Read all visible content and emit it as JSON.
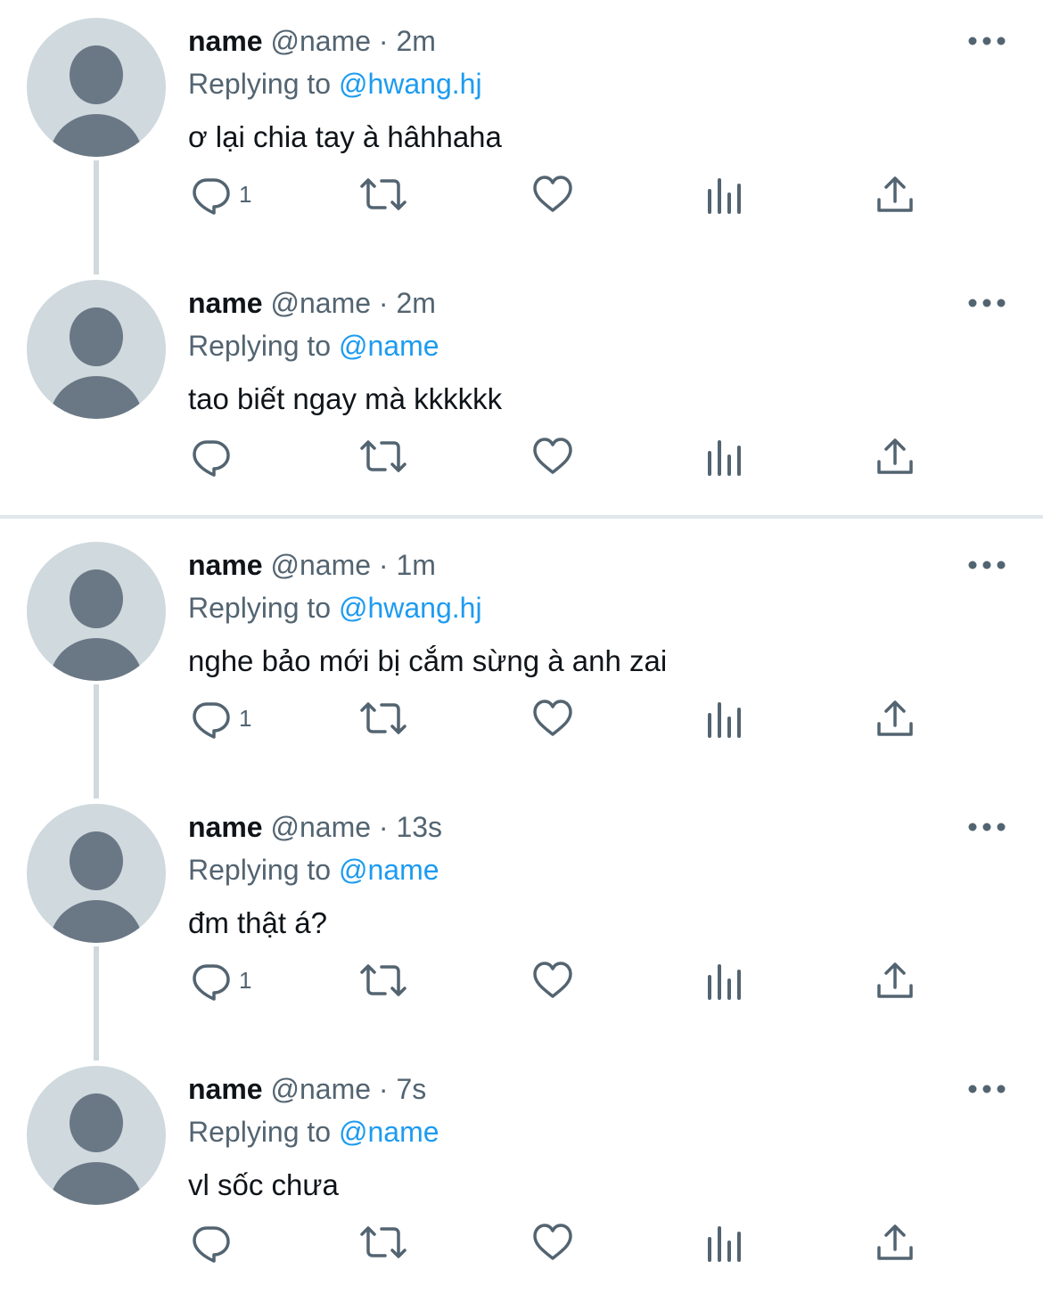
{
  "colors": {
    "text": "#0f1419",
    "secondary": "#536471",
    "mention": "#1d9bf0",
    "avatar_bg": "#cfd9de",
    "avatar_fg": "#6a7885"
  },
  "icons": {
    "reply": "reply-icon",
    "retweet": "retweet-icon",
    "like": "heart-icon",
    "views": "views-icon",
    "share": "share-icon",
    "more": "more-icon"
  },
  "tweets": [
    {
      "name": "name",
      "handle": "@name",
      "dot": "·",
      "time": "2m",
      "replying_prefix": "Replying to",
      "replying_to": "@hwang.hj",
      "text": "ơ lại chia tay à hâhhaha",
      "reply_count": "1"
    },
    {
      "name": "name",
      "handle": "@name",
      "dot": "·",
      "time": "2m",
      "replying_prefix": "Replying to",
      "replying_to": "@name",
      "text": "tao biết ngay mà kkkkkk",
      "reply_count": ""
    },
    {
      "name": "name",
      "handle": "@name",
      "dot": "·",
      "time": "1m",
      "replying_prefix": "Replying to",
      "replying_to": "@hwang.hj",
      "text": "nghe bảo mới bị cắm sừng à anh zai",
      "reply_count": "1"
    },
    {
      "name": "name",
      "handle": "@name",
      "dot": "·",
      "time": "13s",
      "replying_prefix": "Replying to",
      "replying_to": "@name",
      "text": "đm thật á?",
      "reply_count": "1"
    },
    {
      "name": "name",
      "handle": "@name",
      "dot": "·",
      "time": "7s",
      "replying_prefix": "Replying to",
      "replying_to": "@name",
      "text": "vl sốc chưa",
      "reply_count": ""
    }
  ]
}
